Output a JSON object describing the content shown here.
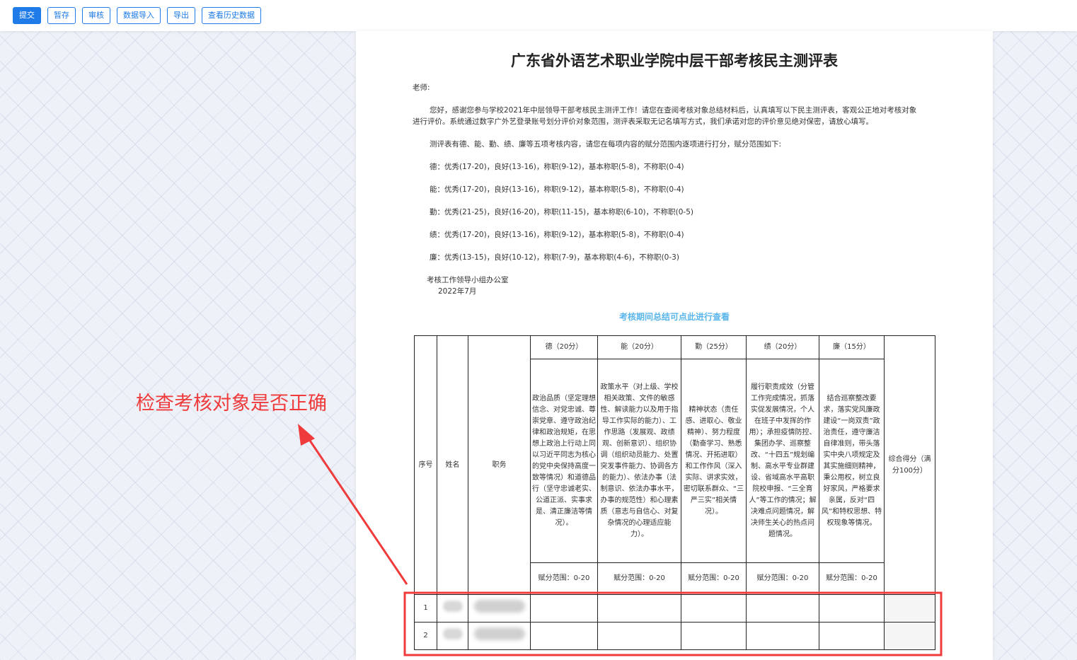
{
  "toolbar": {
    "buttons": [
      "提交",
      "暂存",
      "审核",
      "数据导入",
      "导出",
      "查看历史数据"
    ]
  },
  "doc": {
    "title": "广东省外语艺术职业学院中层干部考核民主测评表",
    "salutation": "老师:",
    "para1_line1": "您好，感谢您参与学校2021年中层领导干部考核民主测评工作！请您在查阅考核对象总结材料后，认真填写以下民主测评表，客观公正地对考核对象",
    "para1_line2": "进行评价。系统通过数字广外艺登录账号划分评价对象范围，测评表采取无记名填写方式，我们承诺对您的评价意见绝对保密，请放心填写。",
    "para2": "测评表有德、能、勤、绩、廉等五项考核内容，请您在每项内容的赋分范围内逐项进行打分，赋分范围如下:",
    "ranges": [
      "德：优秀(17-20)，良好(13-16)，称职(9-12)，基本称职(5-8)，不称职(0-4)",
      "能：优秀(17-20)，良好(13-16)，称职(9-12)，基本称职(5-8)，不称职(0-4)",
      "勤：优秀(21-25)，良好(16-20)，称职(11-15)，基本称职(6-10)，不称职(0-5)",
      "绩：优秀(17-20)，良好(13-16)，称职(9-12)，基本称职(5-8)，不称职(0-4)",
      "廉：优秀(13-15)，良好(10-12)，称职(7-9)，基本称职(4-6)，不称职(0-3)"
    ],
    "signature": "考核工作领导小组办公室",
    "date": "2022年7月",
    "summary_link": "考核期间总结可点此进行查看"
  },
  "table": {
    "col_seq": "序号",
    "col_name": "姓名",
    "col_position": "职务",
    "categories": [
      {
        "header": "德（20分）",
        "description": "政治品质（坚定理想信念、对党忠诚、尊崇党章、遵守政治纪律和政治规矩，在思想上政治上行动上同以习近平同志为核心的党中央保持高度一致等情况）和道德品行（坚守忠诚老实、公道正派、实事求是、清正廉洁等情况）。",
        "range": "赋分范围：0-20"
      },
      {
        "header": "能（20分）",
        "description": "政策水平（对上级、学校相关政策、文件的敏感性、解读能力以及用于指导工作实际的能力）、工作思路（发展观、政绩观、创新意识）、组织协调（组织动员能力、处置突发事件能力、协调各方的能力）、依法办事（法制意识、依法办事水平，办事的规范性）和心理素质（意志与自信心、对复杂情况的心理适应能力）。",
        "range": "赋分范围：0-20"
      },
      {
        "header": "勤（25分）",
        "description": "精神状态（责任感、进取心、敬业精神）、努力程度（勤奋学习、熟悉情况、开拓进取）和工作作风（深入实际、讲求实效，密切联系群众、“三严三实”相关情况）。",
        "range": "赋分范围：0-20"
      },
      {
        "header": "绩（20分）",
        "description": "履行职责成效（分管工作完成情况，抓落实促发展情况，个人在班子中发挥的作用）；承担疫情防控、集团办学、巡察整改、“十四五”规划编制、高水平专业群建设、省域高水平高职院校申报、“三全育人”等工作的情况；解决难点问题情况，解决师生关心的热点问题情况。",
        "range": "赋分范围：0-20"
      },
      {
        "header": "廉（15分）",
        "description": "结合巡察整改要求，落实党风廉政建设“一岗双责”政治责任，遵守廉洁自律准则，带头落实中央八项规定及其实施细则精神，秉公用权，树立良好家风，严格要求亲属，反对“四风”和特权思想、特权现象等情况。",
        "range": "赋分范围：0-20"
      }
    ],
    "col_total": "综合得分（满分100分）",
    "rows": [
      {
        "seq": "1"
      },
      {
        "seq": "2"
      }
    ]
  },
  "annotation": {
    "text": "检查考核对象是否正确",
    "color": "#ef3b3b"
  }
}
